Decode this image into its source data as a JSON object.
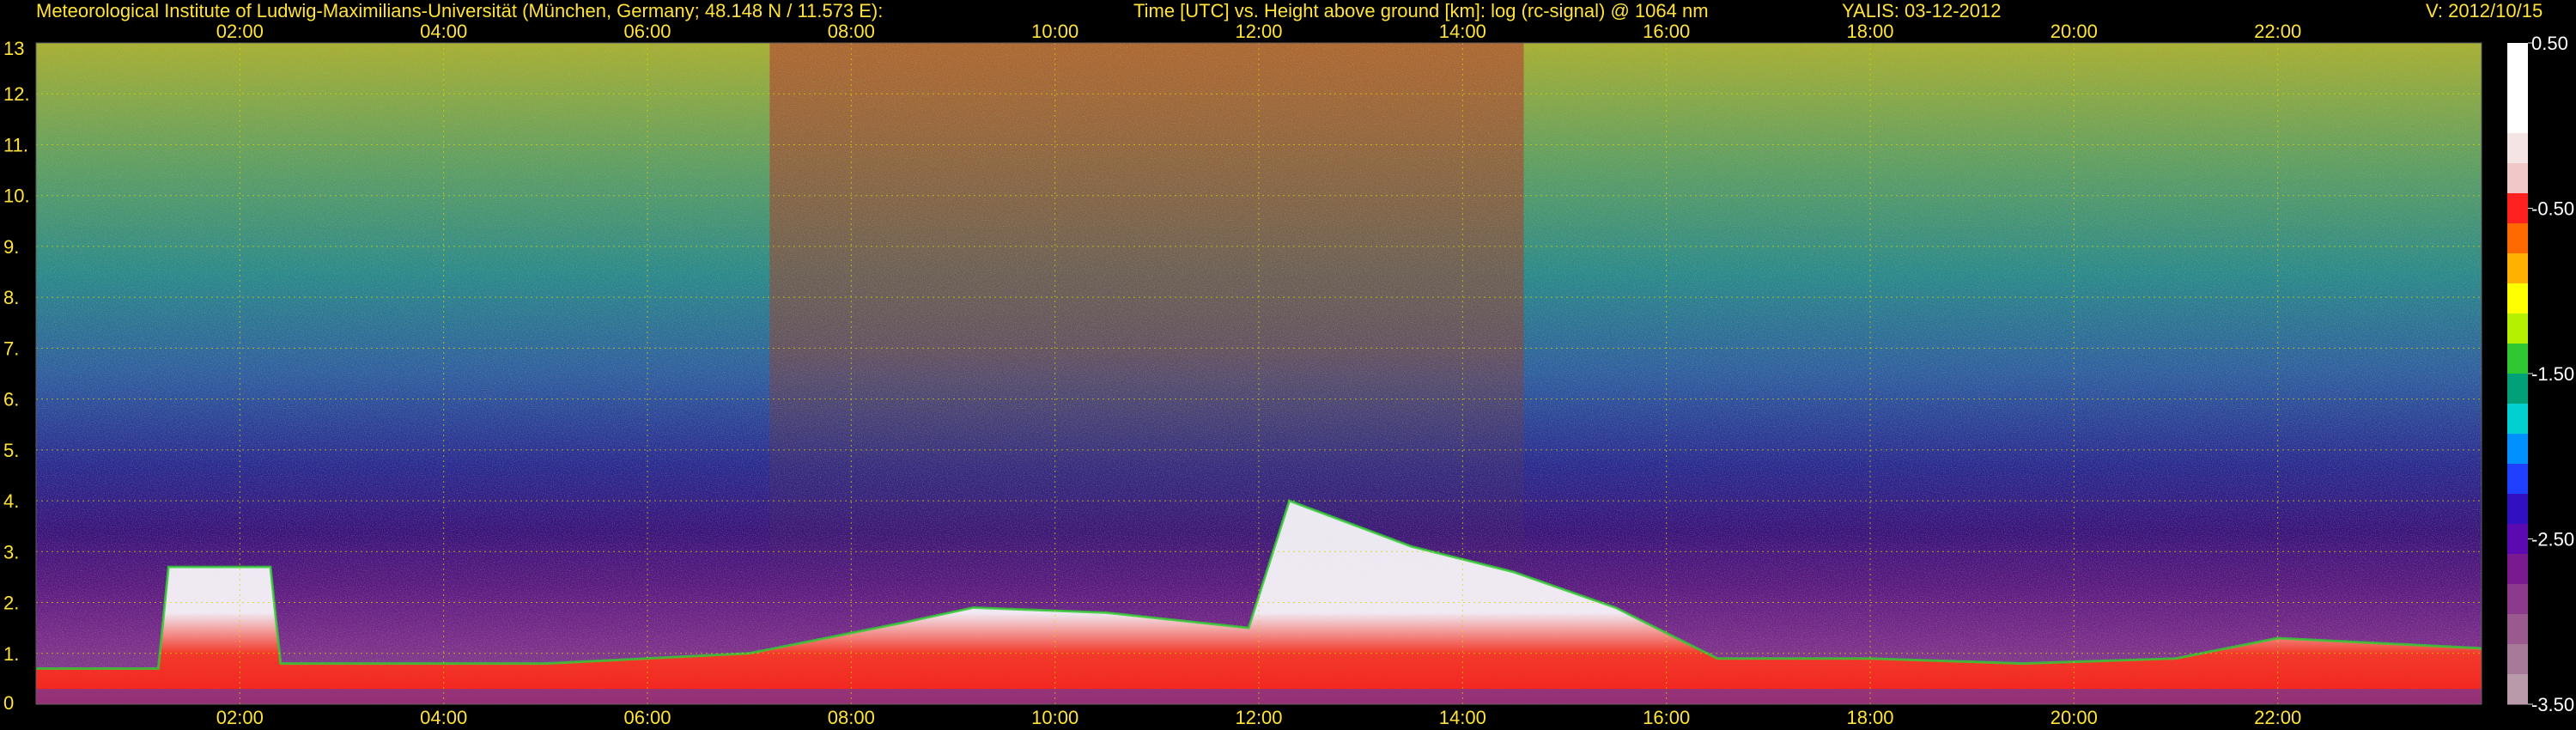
{
  "header": {
    "institute": "Meteorological Institute of Ludwig-Maximilians-Universität (München, Germany; 48.148 N / 11.573 E):",
    "plot_desc": "Time [UTC] vs. Height above ground [km]: log (rc-signal) @ 1064 nm",
    "station_date": "YALIS: 03-12-2012",
    "version": "V: 2012/10/15"
  },
  "chart_data": {
    "type": "heatmap",
    "title": "Time [UTC] vs. Height above ground [km]: log (rc-signal) @ 1064 nm",
    "xlabel": "Time [UTC]",
    "ylabel": "Height above ground [km]",
    "x_range_hours": [
      0,
      24
    ],
    "y_range_km": [
      0,
      13
    ],
    "x_tick_labels": [
      "02:00",
      "04:00",
      "06:00",
      "08:00",
      "10:00",
      "12:00",
      "14:00",
      "16:00",
      "18:00",
      "20:00",
      "22:00"
    ],
    "x_tick_hours": [
      2,
      4,
      6,
      8,
      10,
      12,
      14,
      16,
      18,
      20,
      22
    ],
    "y_ticks": [
      0,
      1,
      2,
      3,
      4,
      5,
      6,
      7,
      8,
      9,
      10,
      11,
      12,
      13
    ],
    "colorbar": {
      "range": [
        -3.5,
        0.5
      ],
      "tick_values": [
        0.5,
        -0.5,
        -1.5,
        -2.5,
        -3.5
      ],
      "tick_labels": [
        "0.50",
        "-0.50",
        "-1.50",
        "-2.50",
        "-3.50"
      ],
      "colors": [
        "#ffffff",
        "#ffffff",
        "#ffffff",
        "#f4e4e4",
        "#f0c8c8",
        "#ff2020",
        "#ff6a00",
        "#ffb000",
        "#ffff00",
        "#b4f000",
        "#30c830",
        "#00a078",
        "#00d0d0",
        "#0090ff",
        "#2040ff",
        "#3010c0",
        "#5a0ab0",
        "#7a1a90",
        "#8c3a8c",
        "#9a5a90",
        "#a87a9a",
        "#b89aaa"
      ]
    },
    "boundary_layer_top_km": {
      "hours": [
        0,
        1.2,
        1.3,
        2.3,
        2.4,
        5.0,
        7.0,
        8.5,
        9.2,
        10.5,
        11.9,
        12.3,
        13.5,
        14.5,
        15.5,
        16.5,
        18.0,
        19.5,
        21.0,
        22.0,
        24.0
      ],
      "values": [
        0.7,
        0.7,
        2.7,
        2.7,
        0.8,
        0.8,
        1.0,
        1.6,
        1.9,
        1.8,
        1.5,
        4.0,
        3.1,
        2.6,
        1.9,
        0.9,
        0.9,
        0.8,
        0.9,
        1.3,
        1.1
      ]
    }
  },
  "colors": {
    "text": "#ffe23a",
    "grid": "#d8d800",
    "background": "#000000"
  }
}
